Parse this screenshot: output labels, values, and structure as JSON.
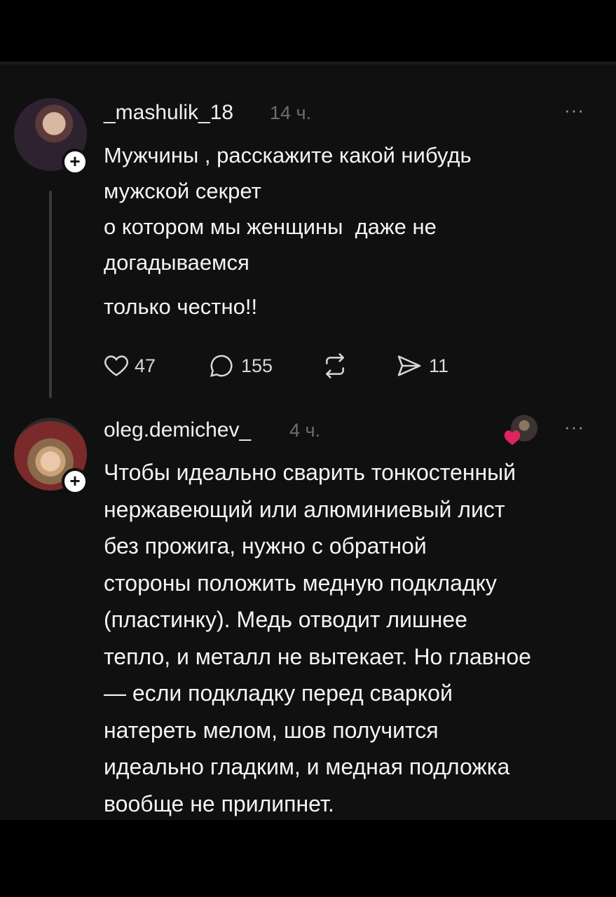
{
  "post": {
    "username": "_mashulik_18",
    "time": "14 ч.",
    "text_part1": "Мужчины , расскажите какой нибудь\nмужской секрет\nо котором мы женщины  даже не\nдогадываемся",
    "text_part2": "только честно!!",
    "likes": "47",
    "comments": "155",
    "shares": "11",
    "more": "···"
  },
  "reply": {
    "username": "oleg.demichev_",
    "time": "4 ч.",
    "text": "Чтобы идеально сварить тонкостенный\nнержавеющий или алюминиевый лист\nбез прожига, нужно с обратной\nстороны положить медную подкладку\n(пластинку). Медь отводит лишнее\nтепло, и металл не вытекает. Но главное\n— если подкладку перед сваркой\nнатереть мелом, шов получится\nидеально гладким, и медная подложка\nвообще не прилипнет.",
    "more": "···"
  },
  "follow_label": "+",
  "colors": {
    "heart": "#e0245e"
  }
}
